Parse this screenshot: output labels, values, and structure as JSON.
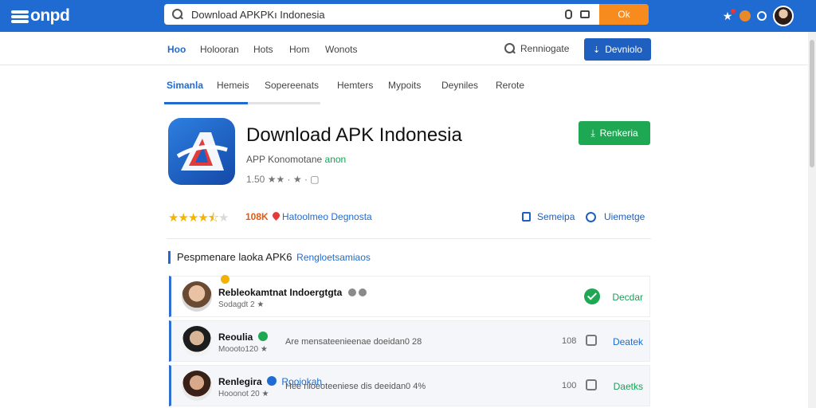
{
  "topbar": {
    "logo": "onpd",
    "search_value": "Download APKPKı Indonesia",
    "search_placeholder": "Download APKPKı Indonesia",
    "search_button": "Ok"
  },
  "nav": {
    "items": [
      "Hoo",
      "Holooran",
      "Hots",
      "Hom",
      "Wonots"
    ],
    "search_label": "Renniogate",
    "primary_button": "Devniolo"
  },
  "tabs": [
    "Simanla",
    "Hemeis",
    "Sopereenats",
    "Hemters",
    "Mypoits",
    "Deyniles",
    "Rerote"
  ],
  "app": {
    "title": "Download APK Indonesia",
    "subtitle": "APP Konomotane",
    "subtitle_tag": "anon",
    "meta": "1.50 ★★ · ★ · ▢",
    "install_button": "Renkeria",
    "rating_stars": 4.5,
    "downloads": "108K",
    "category": "Hatoolmeo Degnosta",
    "action_save": "Semeipa",
    "action_message": "Uiemetge"
  },
  "section": {
    "title": "Pespmenare laoka APK6",
    "link": "Rengloetsamiaos"
  },
  "reviews": [
    {
      "name": "Rebleokamtnat Indoergtgta",
      "date": "Sodagdt 2 ★",
      "text": "",
      "count": "",
      "action": "Decdar"
    },
    {
      "name": "Reoulia",
      "date": "Moooto120 ★",
      "text": "Are mensateenieenae doeidan0 28",
      "count": "108",
      "action": "Deatek"
    },
    {
      "name": "Renlegira",
      "badge": "Rooiokah",
      "date": "Hooonot 20 ★",
      "text": "Hee nioeoteeniese dis deeidan0 4%",
      "count": "100",
      "action": "Daetks"
    }
  ],
  "colors": {
    "brand_blue": "#1f6bd1",
    "install_green": "#1fa853",
    "search_orange": "#f78b1e",
    "downloads_red": "#e25a16"
  }
}
